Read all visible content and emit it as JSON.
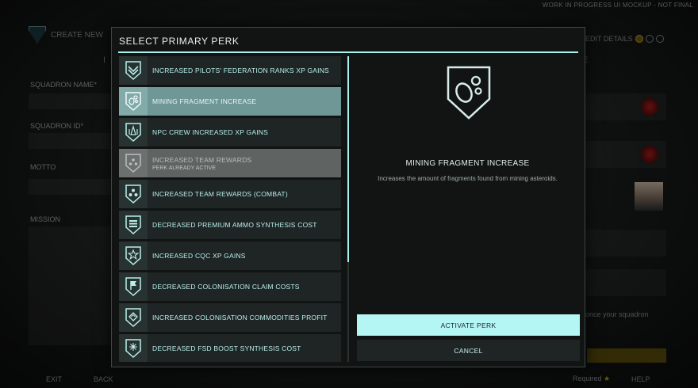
{
  "watermark": "WORK IN PROGRESS UI MOCKUP - NOT FINAL",
  "background": {
    "header_title": "CREATE NEW",
    "tab_left": "I",
    "tab_right": "E",
    "edit_details": "EDIT DETAILS",
    "labels": {
      "squadron_name": "SQUADRON NAME*",
      "squadron_id": "SQUADRON ID*",
      "motto": "MOTTO",
      "mission": "MISSION"
    },
    "note": "once your squadron",
    "footer": {
      "exit": "EXIT",
      "back": "BACK",
      "required": "Required",
      "help": "HELP"
    }
  },
  "modal": {
    "title": "SELECT PRIMARY PERK",
    "perks": [
      {
        "label": "INCREASED PILOTS' FEDERATION RANKS XP GAINS",
        "sub": "",
        "icon": "chevron-rank-icon",
        "state": "normal"
      },
      {
        "label": "MINING FRAGMENT INCREASE",
        "sub": "",
        "icon": "mining-fragments-icon",
        "state": "selected"
      },
      {
        "label": "NPC CREW INCREASED XP GAINS",
        "sub": "",
        "icon": "crew-icon",
        "state": "normal"
      },
      {
        "label": "INCREASED TEAM REWARDS",
        "sub": "PERK ALREADY ACTIVE",
        "icon": "team-icon",
        "state": "disabled"
      },
      {
        "label": "INCREASED TEAM REWARDS (COMBAT)",
        "sub": "",
        "icon": "team-combat-icon",
        "state": "normal"
      },
      {
        "label": "DECREASED PREMIUM AMMO SYNTHESIS COST",
        "sub": "",
        "icon": "ammo-icon",
        "state": "normal"
      },
      {
        "label": "INCREASED CQC XP GAINS",
        "sub": "",
        "icon": "cqc-star-icon",
        "state": "normal"
      },
      {
        "label": "DECREASED COLONISATION CLAIM COSTS",
        "sub": "",
        "icon": "flag-icon",
        "state": "normal"
      },
      {
        "label": "INCREASED COLONISATION COMMODITIES PROFIT",
        "sub": "",
        "icon": "commodities-icon",
        "state": "normal"
      },
      {
        "label": "DECREASED FSD BOOST SYNTHESIS COST",
        "sub": "",
        "icon": "fsd-boost-icon",
        "state": "normal"
      }
    ],
    "detail": {
      "name": "MINING FRAGMENT INCREASE",
      "description": "Increases the amount of fragments found from mining asteroids.",
      "icon": "mining-fragments-icon"
    },
    "buttons": {
      "activate": "ACTIVATE PERK",
      "cancel": "CANCEL"
    }
  },
  "colors": {
    "accent": "#a3f2f0",
    "selected_row": "#6f9795",
    "disabled_row": "#5f6362",
    "button_primary": "#b4f6f4",
    "required_star": "#c9a227"
  }
}
